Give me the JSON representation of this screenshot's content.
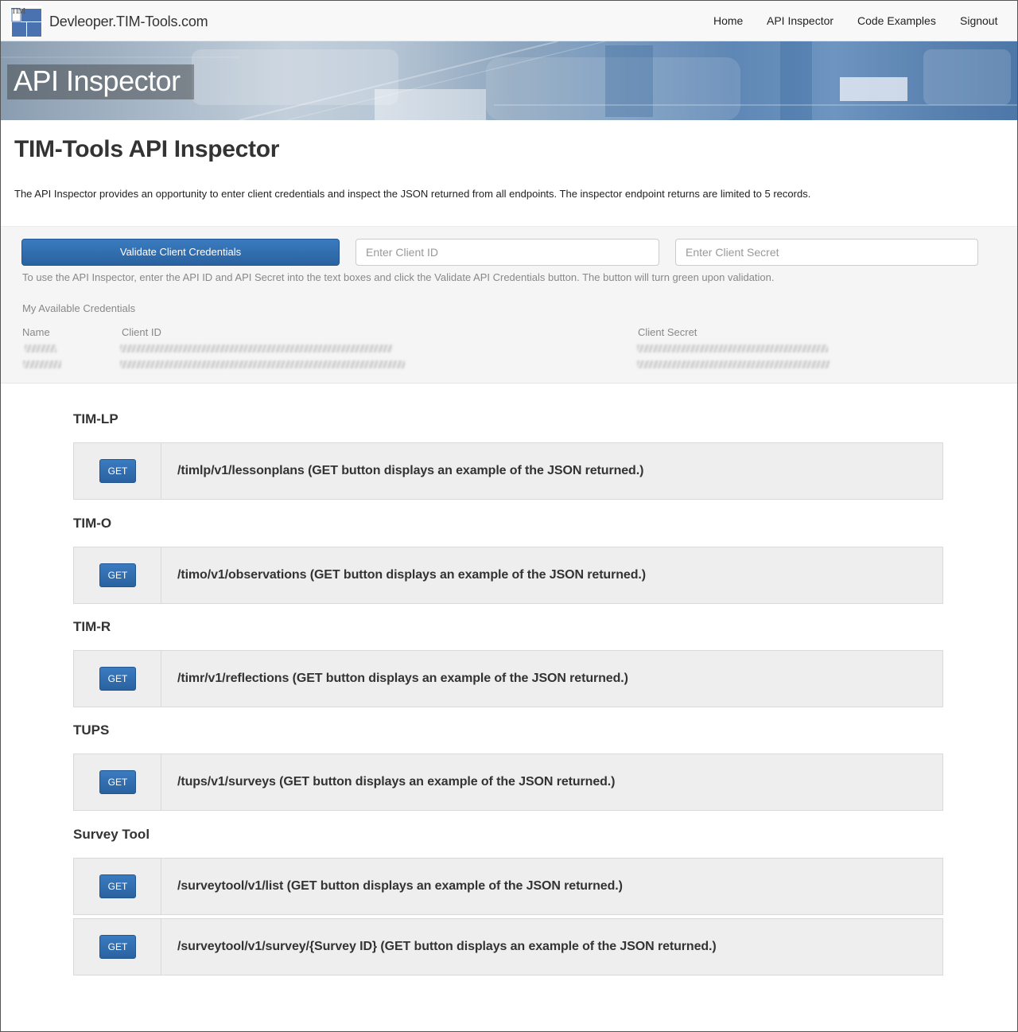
{
  "navbar": {
    "brand": "Devleoper.TIM-Tools.com",
    "logo_text": "TIM",
    "links": [
      "Home",
      "API Inspector",
      "Code Examples",
      "Signout"
    ]
  },
  "hero": {
    "title": "API Inspector"
  },
  "intro": {
    "title": "TIM-Tools API Inspector",
    "description": "The API Inspector provides an opportunity to enter client credentials and inspect the JSON returned from all endpoints. The inspector endpoint returns are limited to 5 records."
  },
  "credentials": {
    "validate_label": "Validate Client Credentials",
    "client_id_placeholder": "Enter Client ID",
    "client_secret_placeholder": "Enter Client Secret",
    "help": "To use the API Inspector, enter the API ID and API Secret into the text boxes and click the Validate API Credentials button. The button will turn green upon validation.",
    "available_label": "My Available Credentials",
    "columns": [
      "Name",
      "Client ID",
      "Client Secret"
    ]
  },
  "sections": [
    {
      "title": "TIM-LP",
      "endpoints": [
        {
          "method": "GET",
          "path": "/timlp/v1/lessonplans (GET button displays an example of the JSON returned.)"
        }
      ]
    },
    {
      "title": "TIM-O",
      "endpoints": [
        {
          "method": "GET",
          "path": "/timo/v1/observations (GET button displays an example of the JSON returned.)"
        }
      ]
    },
    {
      "title": "TIM-R",
      "endpoints": [
        {
          "method": "GET",
          "path": "/timr/v1/reflections (GET button displays an example of the JSON returned.)"
        }
      ]
    },
    {
      "title": "TUPS",
      "endpoints": [
        {
          "method": "GET",
          "path": "/tups/v1/surveys (GET button displays an example of the JSON returned.)"
        }
      ]
    },
    {
      "title": "Survey Tool",
      "endpoints": [
        {
          "method": "GET",
          "path": "/surveytool/v1/list (GET button displays an example of the JSON returned.)"
        },
        {
          "method": "GET",
          "path": "/surveytool/v1/survey/{Survey ID} (GET button displays an example of the JSON returned.)"
        }
      ]
    }
  ],
  "colors": {
    "primary_button": "#2f6fb3",
    "navbar_bg": "#f8f8f8",
    "endpoint_bg": "#efeeef"
  }
}
